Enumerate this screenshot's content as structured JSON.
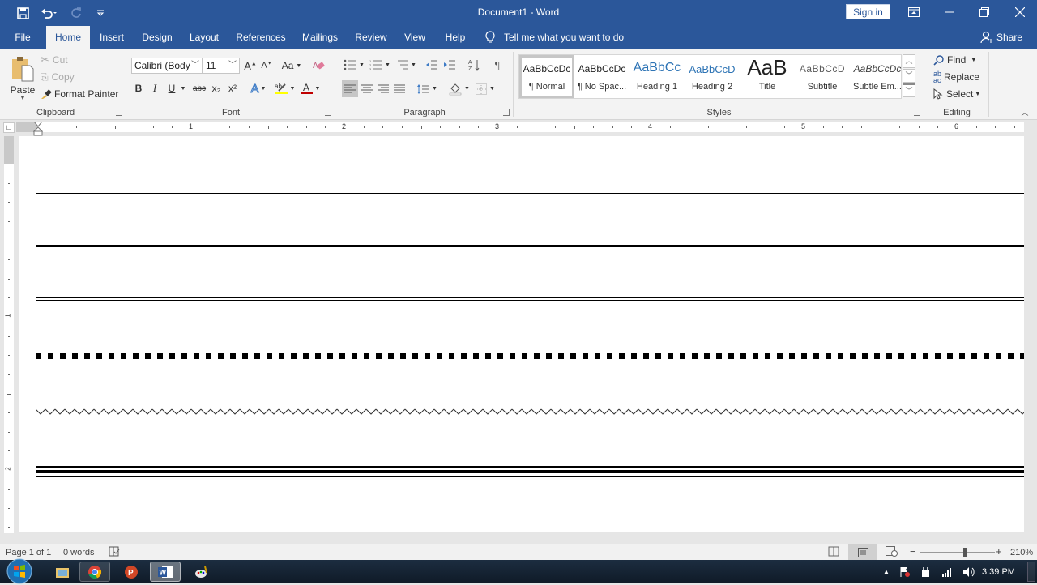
{
  "window": {
    "title": "Document1  -  Word",
    "sign_in": "Sign in"
  },
  "qat": {
    "icons": [
      "save-icon",
      "undo-icon",
      "redo-icon",
      "customize-qat-icon"
    ]
  },
  "tabs": [
    {
      "label": "File"
    },
    {
      "label": "Home",
      "active": true
    },
    {
      "label": "Insert"
    },
    {
      "label": "Design"
    },
    {
      "label": "Layout"
    },
    {
      "label": "References"
    },
    {
      "label": "Mailings"
    },
    {
      "label": "Review"
    },
    {
      "label": "View"
    },
    {
      "label": "Help"
    }
  ],
  "tell_me": "Tell me what you want to do",
  "share": "Share",
  "ribbon": {
    "clipboard": {
      "label": "Clipboard",
      "paste": "Paste",
      "cut": "Cut",
      "copy": "Copy",
      "format_painter": "Format Painter"
    },
    "font": {
      "label": "Font",
      "font_name": "Calibri (Body",
      "font_size": "11",
      "change_case": "Aa",
      "bold": "B",
      "italic": "I",
      "underline": "U",
      "strikethrough": "abc",
      "subscript": "x₂",
      "superscript": "x²",
      "highlight_color": "#ffff00",
      "font_color": "#c00000"
    },
    "paragraph": {
      "label": "Paragraph",
      "show_marks": "¶"
    },
    "styles": {
      "label": "Styles",
      "items": [
        {
          "sample": "AaBbCcDc",
          "name": "¶ Normal",
          "selected": true
        },
        {
          "sample": "AaBbCcDc",
          "name": "¶ No Spac..."
        },
        {
          "sample": "AaBbCc",
          "name": "Heading 1"
        },
        {
          "sample": "AaBbCcD",
          "name": "Heading 2"
        },
        {
          "sample": "AaB",
          "name": "Title"
        },
        {
          "sample": "AaBbCcD",
          "name": "Subtitle"
        },
        {
          "sample": "AaBbCcDc",
          "name": "Subtle Em..."
        }
      ]
    },
    "editing": {
      "label": "Editing",
      "find": "Find",
      "replace": "Replace",
      "select": "Select"
    }
  },
  "ruler": {
    "h_numbers": [
      "1",
      "2",
      "3",
      "4",
      "5",
      "6"
    ],
    "v_numbers": [
      "1",
      "2"
    ]
  },
  "document": {
    "border_lines": [
      {
        "style": "single-thin"
      },
      {
        "style": "single-thick"
      },
      {
        "style": "double"
      },
      {
        "style": "square-dotted"
      },
      {
        "style": "wavy"
      },
      {
        "style": "thin-thick-thin"
      }
    ]
  },
  "status": {
    "page": "Page 1 of 1",
    "words": "0 words",
    "zoom": "210%",
    "zoom_minus": "−",
    "zoom_plus": "+"
  },
  "taskbar": {
    "apps": [
      "Start",
      "File Explorer",
      "Chrome",
      "PowerPoint",
      "Word",
      "Paint"
    ],
    "time": "3:39 PM"
  }
}
